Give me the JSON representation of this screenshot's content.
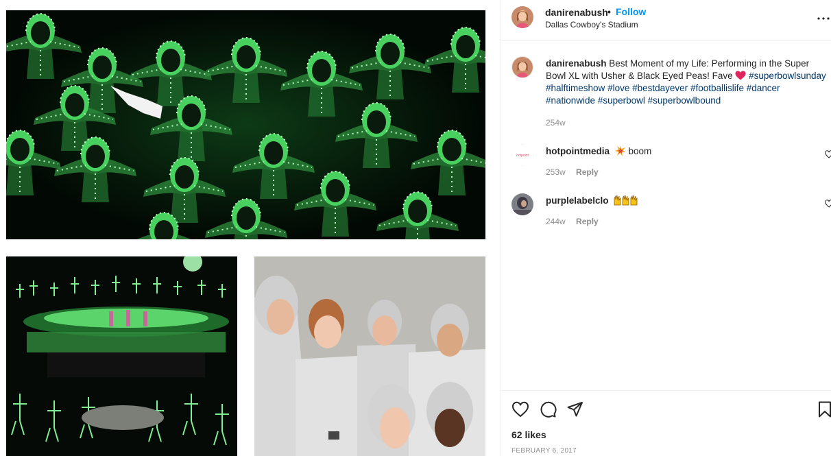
{
  "post": {
    "username": "danirenabush",
    "separator": "•",
    "follow_label": "Follow",
    "location": "Dallas Cowboy's Stadium"
  },
  "caption": {
    "username": "danirenabush",
    "text_before": "Best Moment of my Life: Performing in the Super Bowl XL with Usher & Black Eyed Peas! Fave",
    "hashtags": [
      "#superbowlsunday",
      "#halftimeshow",
      "#love",
      "#bestdayever",
      "#footballislife",
      "#dancer",
      "#nationwide",
      "#superbowl",
      "#superbowlbound"
    ],
    "time": "254w"
  },
  "comments": [
    {
      "username": "hotpointmedia",
      "text": "boom",
      "emoji_icon": "collision-icon",
      "time": "253w",
      "reply_label": "Reply",
      "avatar_text": "hotpoint"
    },
    {
      "username": "purplelabelclo",
      "text": "",
      "emoji_icon": "raising-hands-icon",
      "time": "244w",
      "reply_label": "Reply"
    }
  ],
  "footer": {
    "likes": "62 likes",
    "date": "FEBRUARY 6, 2017"
  },
  "icons": {
    "more": "more-horizontal-icon",
    "like": "heart-outline-icon",
    "comment": "comment-bubble-icon",
    "share": "paper-plane-icon",
    "save": "bookmark-icon"
  },
  "colors": {
    "follow": "#0095f6",
    "hashtag": "#00376b",
    "muted": "#8e8e8e",
    "heart_emoji": "#e0245e",
    "led_green": "#39d353"
  }
}
